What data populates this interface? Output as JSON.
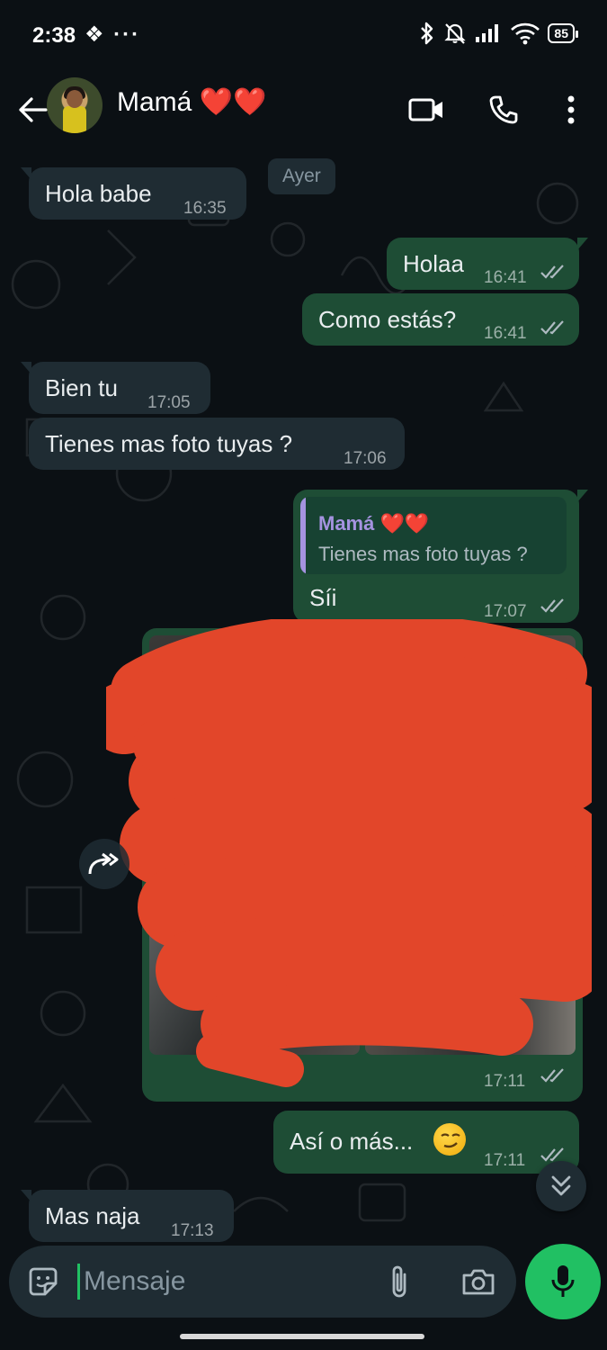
{
  "status_bar": {
    "time": "2:38",
    "extra": "❖ ···",
    "battery": "85"
  },
  "header": {
    "contact_name": "Mamá ❤️❤️"
  },
  "chat": {
    "date_chip": "Ayer",
    "messages": [
      {
        "direction": "in",
        "text": "Hola babe",
        "time": "16:35"
      },
      {
        "direction": "out",
        "text": "Holaa",
        "time": "16:41",
        "read": true
      },
      {
        "direction": "out",
        "text": "Como estás?",
        "time": "16:41",
        "read": true
      },
      {
        "direction": "in",
        "text": "Bien tu",
        "time": "17:05"
      },
      {
        "direction": "in",
        "text": "Tienes mas foto tuyas ?",
        "time": "17:06"
      },
      {
        "direction": "out",
        "text": "Síi",
        "time": "17:07",
        "read": true,
        "quote": {
          "author": "Mamá ❤️❤️",
          "text": "Tienes mas foto tuyas ?"
        }
      },
      {
        "direction": "out",
        "type": "media_grid",
        "photo_count": 4,
        "redacted": true,
        "time": "17:11",
        "read": true
      },
      {
        "direction": "out",
        "text": "Así o más...",
        "emoji": "smirking-face",
        "time": "17:11",
        "read": true
      },
      {
        "direction": "in",
        "text": "Mas naja",
        "time": "17:13"
      }
    ]
  },
  "input": {
    "placeholder": "Mensaje"
  },
  "colors": {
    "background": "#0b1014",
    "incoming_bubble": "#1f2c33",
    "outgoing_bubble": "#1e4d35",
    "accent": "#21c063",
    "quote_author": "#a593e0",
    "redaction": "#e2462a"
  }
}
